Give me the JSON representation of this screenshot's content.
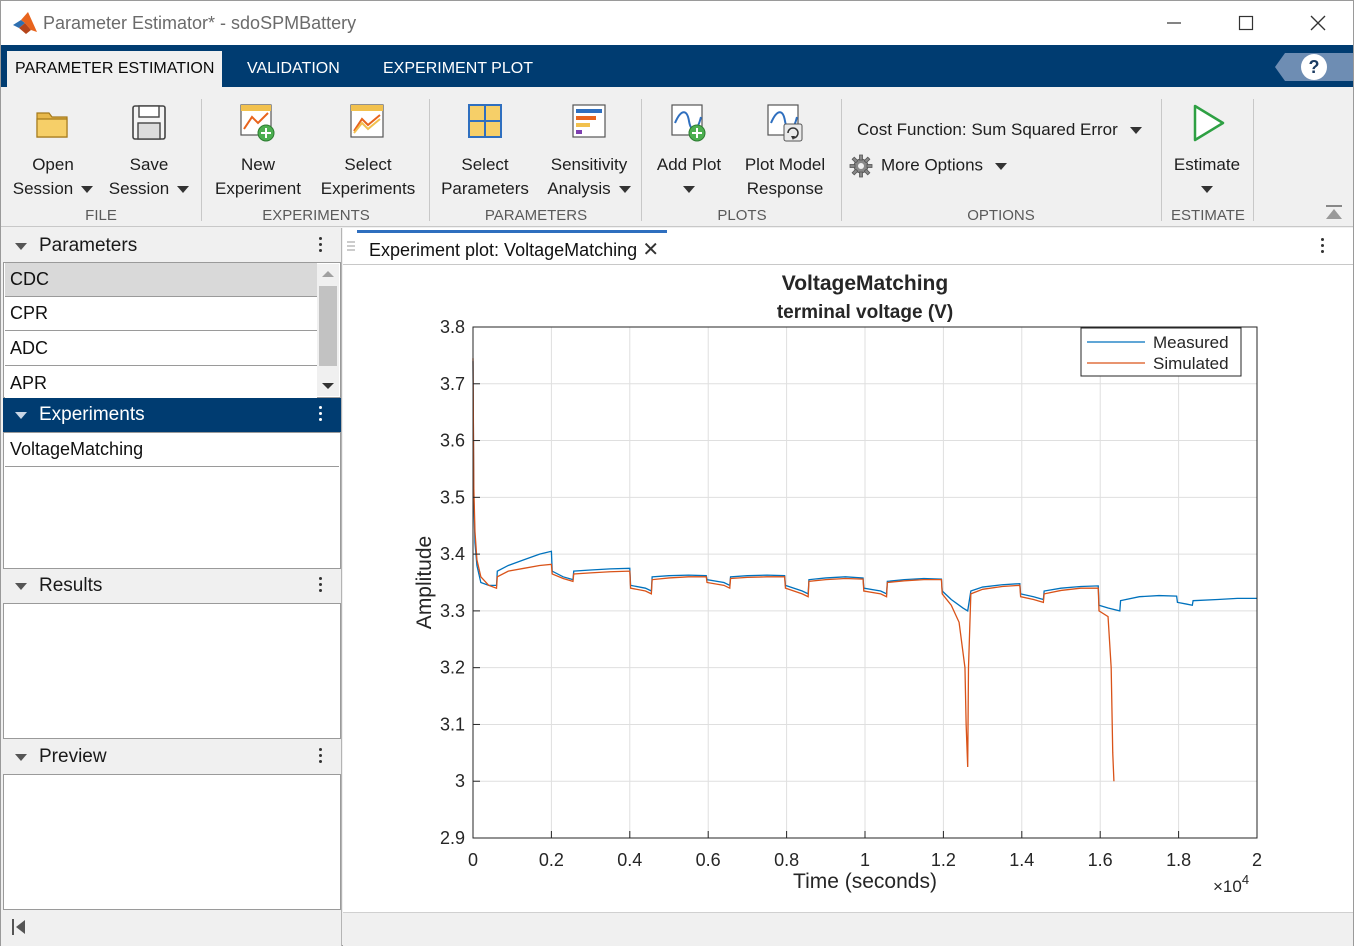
{
  "window": {
    "title": "Parameter Estimator* - sdoSPMBattery"
  },
  "ribbon_tabs": [
    {
      "label": "PARAMETER ESTIMATION",
      "active": true
    },
    {
      "label": "VALIDATION",
      "active": false
    },
    {
      "label": "EXPERIMENT PLOT",
      "active": false
    }
  ],
  "help": {
    "label": "?"
  },
  "toolstrip": {
    "file": {
      "label": "FILE",
      "open": {
        "line1": "Open",
        "line2": "Session"
      },
      "save": {
        "line1": "Save",
        "line2": "Session"
      }
    },
    "experiments": {
      "label": "EXPERIMENTS",
      "new": {
        "line1": "New",
        "line2": "Experiment"
      },
      "select": {
        "line1": "Select",
        "line2": "Experiments"
      }
    },
    "parameters": {
      "label": "PARAMETERS",
      "select": {
        "line1": "Select",
        "line2": "Parameters"
      },
      "sensitivity": {
        "line1": "Sensitivity",
        "line2": "Analysis"
      }
    },
    "plots": {
      "label": "PLOTS",
      "add": {
        "line1": "Add Plot"
      },
      "model": {
        "line1": "Plot Model",
        "line2": "Response"
      }
    },
    "options": {
      "label": "OPTIONS",
      "cost_function": "Cost Function: Sum Squared Error",
      "more": "More Options"
    },
    "estimate": {
      "label": "ESTIMATE",
      "button": "Estimate"
    }
  },
  "left_panel": {
    "parameters": {
      "title": "Parameters",
      "items": [
        "CDC",
        "CPR",
        "ADC",
        "APR"
      ],
      "selected": "CDC"
    },
    "experiments": {
      "title": "Experiments",
      "items": [
        "VoltageMatching"
      ]
    },
    "results": {
      "title": "Results"
    },
    "preview": {
      "title": "Preview"
    }
  },
  "document": {
    "tab_title": "Experiment plot: VoltageMatching",
    "close_glyph": "✕"
  },
  "chart_data": {
    "type": "line",
    "title": "VoltageMatching",
    "subtitle": "terminal voltage (V)",
    "xlabel": "Time (seconds)",
    "ylabel": "Amplitude",
    "x_exponent_label": "×10",
    "x_exponent_power": "4",
    "xlim": [
      0,
      2
    ],
    "ylim": [
      2.9,
      3.8
    ],
    "xticks": [
      "0",
      "0.2",
      "0.4",
      "0.6",
      "0.8",
      "1",
      "1.2",
      "1.4",
      "1.6",
      "1.8",
      "2"
    ],
    "yticks": [
      "2.9",
      "3",
      "3.1",
      "3.2",
      "3.3",
      "3.4",
      "3.5",
      "3.6",
      "3.7",
      "3.8"
    ],
    "grid": true,
    "legend_position": "top-right",
    "series": [
      {
        "name": "Measured",
        "color": "#0072bd",
        "x": [
          0,
          0.002,
          0.005,
          0.01,
          0.02,
          0.04,
          0.06,
          0.062,
          0.09,
          0.13,
          0.17,
          0.2,
          0.202,
          0.23,
          0.255,
          0.257,
          0.3,
          0.35,
          0.4,
          0.402,
          0.44,
          0.455,
          0.457,
          0.5,
          0.55,
          0.595,
          0.597,
          0.64,
          0.655,
          0.657,
          0.7,
          0.75,
          0.795,
          0.797,
          0.84,
          0.855,
          0.857,
          0.9,
          0.95,
          0.995,
          0.997,
          1.04,
          1.055,
          1.057,
          1.1,
          1.15,
          1.195,
          1.197,
          1.22,
          1.25,
          1.262,
          1.27,
          1.3,
          1.35,
          1.395,
          1.397,
          1.43,
          1.455,
          1.457,
          1.5,
          1.55,
          1.595,
          1.597,
          1.62,
          1.65,
          1.652,
          1.7,
          1.75,
          1.795,
          1.797,
          1.82,
          1.835,
          1.837,
          1.9,
          1.95,
          2.0
        ],
        "y": [
          3.74,
          3.5,
          3.42,
          3.38,
          3.35,
          3.345,
          3.345,
          3.37,
          3.38,
          3.39,
          3.4,
          3.405,
          3.37,
          3.36,
          3.355,
          3.37,
          3.372,
          3.374,
          3.375,
          3.345,
          3.34,
          3.335,
          3.36,
          3.362,
          3.363,
          3.362,
          3.355,
          3.35,
          3.345,
          3.36,
          3.362,
          3.363,
          3.362,
          3.345,
          3.335,
          3.33,
          3.355,
          3.358,
          3.36,
          3.358,
          3.34,
          3.335,
          3.33,
          3.352,
          3.355,
          3.357,
          3.356,
          3.335,
          3.32,
          3.305,
          3.3,
          3.335,
          3.342,
          3.346,
          3.348,
          3.33,
          3.325,
          3.32,
          3.335,
          3.34,
          3.343,
          3.344,
          3.31,
          3.305,
          3.3,
          3.318,
          3.325,
          3.327,
          3.326,
          3.315,
          3.312,
          3.31,
          3.318,
          3.32,
          3.322,
          3.322
        ]
      },
      {
        "name": "Simulated",
        "color": "#d95319",
        "x": [
          0,
          0.002,
          0.005,
          0.01,
          0.02,
          0.04,
          0.06,
          0.062,
          0.09,
          0.13,
          0.17,
          0.2,
          0.202,
          0.23,
          0.255,
          0.257,
          0.3,
          0.35,
          0.4,
          0.402,
          0.44,
          0.455,
          0.457,
          0.5,
          0.55,
          0.595,
          0.597,
          0.64,
          0.655,
          0.657,
          0.7,
          0.75,
          0.795,
          0.797,
          0.84,
          0.855,
          0.857,
          0.9,
          0.95,
          0.995,
          0.997,
          1.04,
          1.055,
          1.057,
          1.1,
          1.15,
          1.195,
          1.197,
          1.22,
          1.24,
          1.255,
          1.258,
          1.262,
          1.264,
          1.27,
          1.3,
          1.35,
          1.395,
          1.397,
          1.43,
          1.455,
          1.457,
          1.5,
          1.55,
          1.595,
          1.597,
          1.62,
          1.628,
          1.632,
          1.635
        ],
        "y": [
          3.745,
          3.52,
          3.44,
          3.39,
          3.36,
          3.345,
          3.34,
          3.36,
          3.37,
          3.375,
          3.38,
          3.382,
          3.365,
          3.357,
          3.352,
          3.365,
          3.367,
          3.369,
          3.37,
          3.34,
          3.335,
          3.33,
          3.355,
          3.358,
          3.36,
          3.36,
          3.35,
          3.345,
          3.34,
          3.357,
          3.359,
          3.36,
          3.36,
          3.34,
          3.33,
          3.325,
          3.352,
          3.355,
          3.357,
          3.356,
          3.335,
          3.33,
          3.325,
          3.35,
          3.353,
          3.355,
          3.355,
          3.33,
          3.31,
          3.28,
          3.2,
          3.1,
          3.025,
          3.2,
          3.33,
          3.338,
          3.343,
          3.345,
          3.325,
          3.32,
          3.315,
          3.33,
          3.336,
          3.34,
          3.34,
          3.3,
          3.29,
          3.2,
          3.05,
          3.0
        ]
      }
    ]
  }
}
